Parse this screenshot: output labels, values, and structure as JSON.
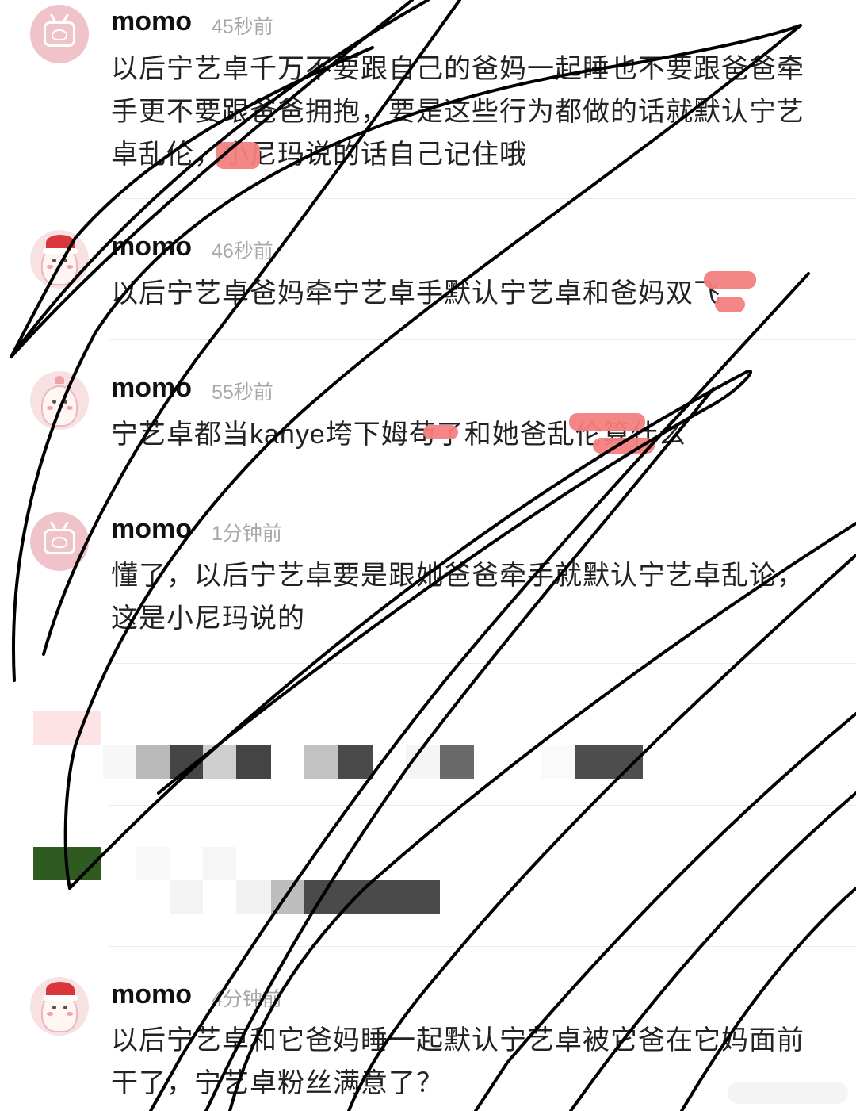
{
  "comments": [
    {
      "user": "momo",
      "time": "45秒前",
      "text": "以后宁艺卓千万不要跟自己的爸妈一起睡也不要跟爸爸牵手更不要跟爸爸拥抱，要是这些行为都做的话就默认宁艺卓乱伦，小尼玛说的话自己记住哦",
      "avatar": "tv-icon"
    },
    {
      "user": "momo",
      "time": "46秒前",
      "text": "以后宁艺卓爸妈牵宁艺卓手默认宁艺卓和爸妈双飞",
      "avatar": "character-icon"
    },
    {
      "user": "momo",
      "time": "55秒前",
      "text": "宁艺卓都当kanye垮下姆苟了和她爸乱伦算什么",
      "avatar": "character-icon"
    },
    {
      "user": "momo",
      "time": "1分钟前",
      "text": "懂了，以后宁艺卓要是跟她爸爸牵手就默认宁艺卓乱论，这是小尼玛说的",
      "avatar": "tv-icon"
    },
    {
      "user": "momo",
      "time": "4分钟前",
      "text": "以后宁艺卓和它爸妈睡一起默认宁艺卓被它爸在它妈面前干了，宁艺卓粉丝满意了？",
      "avatar": "character-icon"
    }
  ],
  "colors": {
    "name": "#111111",
    "time": "#a8a8a8",
    "text": "#222222",
    "divider": "#ececec",
    "redaction": "#f47f80",
    "scribble": "#000000"
  }
}
